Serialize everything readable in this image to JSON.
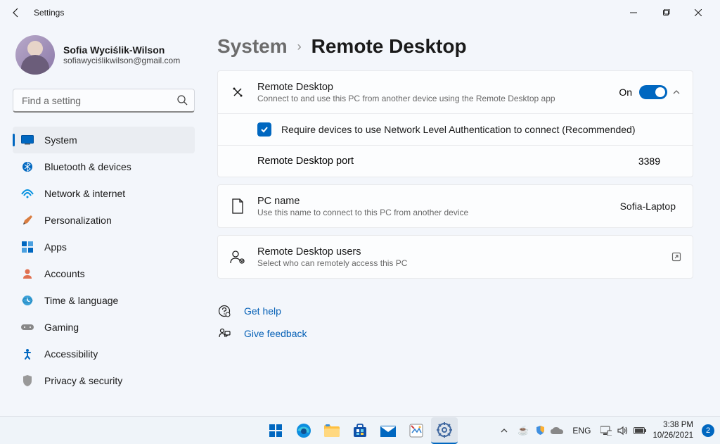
{
  "window": {
    "title": "Settings"
  },
  "user": {
    "name": "Sofia Wyciślik-Wilson",
    "email": "sofiawyciślikwilson@gmail.com"
  },
  "search": {
    "placeholder": "Find a setting"
  },
  "nav": {
    "system": "System",
    "bluetooth": "Bluetooth & devices",
    "network": "Network & internet",
    "personalization": "Personalization",
    "apps": "Apps",
    "accounts": "Accounts",
    "time": "Time & language",
    "gaming": "Gaming",
    "accessibility": "Accessibility",
    "privacy": "Privacy & security"
  },
  "breadcrumb": {
    "parent": "System",
    "current": "Remote Desktop"
  },
  "remote": {
    "title": "Remote Desktop",
    "desc": "Connect to and use this PC from another device using the Remote Desktop app",
    "toggle_state": "On",
    "nla_label": "Require devices to use Network Level Authentication to connect (Recommended)",
    "port_label": "Remote Desktop port",
    "port_value": "3389"
  },
  "pc": {
    "title": "PC name",
    "desc": "Use this name to connect to this PC from another device",
    "value": "Sofia-Laptop"
  },
  "users": {
    "title": "Remote Desktop users",
    "desc": "Select who can remotely access this PC"
  },
  "help": {
    "get_help": "Get help",
    "feedback": "Give feedback"
  },
  "taskbar": {
    "lang": "ENG",
    "time": "3:38 PM",
    "date": "10/26/2021",
    "badge": "2"
  }
}
